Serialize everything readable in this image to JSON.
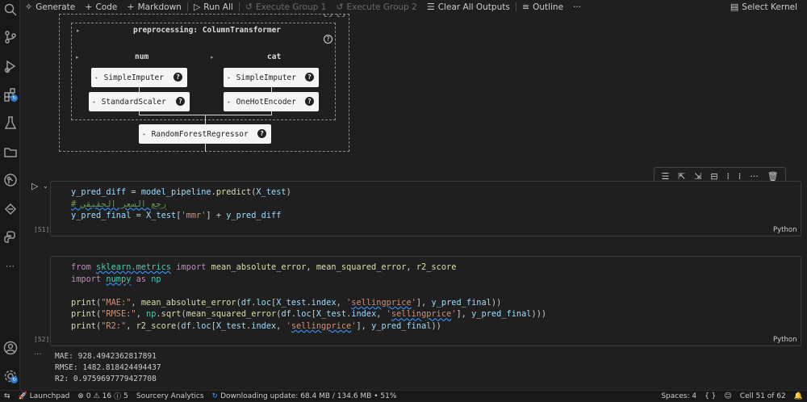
{
  "toolbar": {
    "generate": "Generate",
    "code": "Code",
    "markdown": "Markdown",
    "run_all": "Run All",
    "execute_group_1": "Execute Group 1",
    "execute_group_2": "Execute Group 2",
    "clear_outputs": "Clear All Outputs",
    "outline": "Outline",
    "more": "···",
    "select_kernel": "Select Kernel"
  },
  "diagram": {
    "preprocessing_label": "preprocessing: ColumnTransformer",
    "num_label": "num",
    "cat_label": "cat",
    "num_imputer": "SimpleImputer",
    "num_scaler": "StandardScaler",
    "cat_imputer": "SimpleImputer",
    "cat_encoder": "OneHotEncoder",
    "regressor": "RandomForestRegressor",
    "help_glyph": "?"
  },
  "cells": [
    {
      "number": "[51]",
      "language": "Python",
      "lines": [
        "y_pred_diff = model_pipeline.predict(X_test)",
        "# رجع السعر الحقيقي",
        "y_pred_final = X_test['mmr'] + y_pred_diff"
      ]
    },
    {
      "number": "[52]",
      "language": "Python",
      "lines": [
        "from sklearn.metrics import mean_absolute_error, mean_squared_error, r2_score",
        "import numpy as np",
        "",
        "print(\"MAE:\", mean_absolute_error(df.loc[X_test.index, 'sellingprice'], y_pred_final))",
        "print(\"RMSE:\", np.sqrt(mean_squared_error(df.loc[X_test.index, 'sellingprice'], y_pred_final)))",
        "print(\"R2:\", r2_score(df.loc[X_test.index, 'sellingprice'], y_pred_final))"
      ]
    }
  ],
  "output": {
    "ellipsis": "···",
    "mae": "MAE: 928.4942362817891",
    "rmse": "RMSE: 1482.818424494437",
    "r2": "R2: 0.9759697779427708"
  },
  "status": {
    "launchpad": "Launchpad",
    "errors": "0",
    "warnings": "16",
    "info": "5",
    "sourcery": "Sourcery Analytics",
    "downloading": "Downloading update: 68.4 MB / 134.6 MB • 51%",
    "spaces": "Spaces: 4",
    "braces": "{ }",
    "cell": "Cell 51 of 62"
  },
  "icons": {
    "activity_bar": [
      "search-icon",
      "source-control-icon",
      "run-debug-icon",
      "extensions-icon",
      "testing-icon",
      "explorer-folder-icon",
      "git-graph-icon",
      "remote-icon",
      "python-icon",
      "more-icon",
      "account-icon",
      "settings-gear-icon"
    ]
  }
}
